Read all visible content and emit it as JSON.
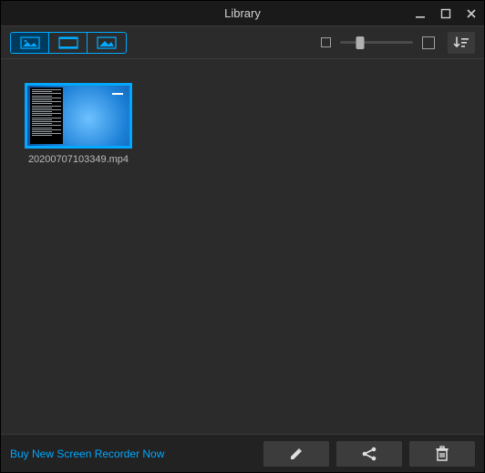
{
  "window": {
    "title": "Library"
  },
  "media": {
    "items": [
      {
        "filename": "20200707103349.mp4"
      }
    ]
  },
  "footer": {
    "promo_text": "Buy New Screen Recorder Now"
  },
  "colors": {
    "accent": "#00a8ff"
  }
}
